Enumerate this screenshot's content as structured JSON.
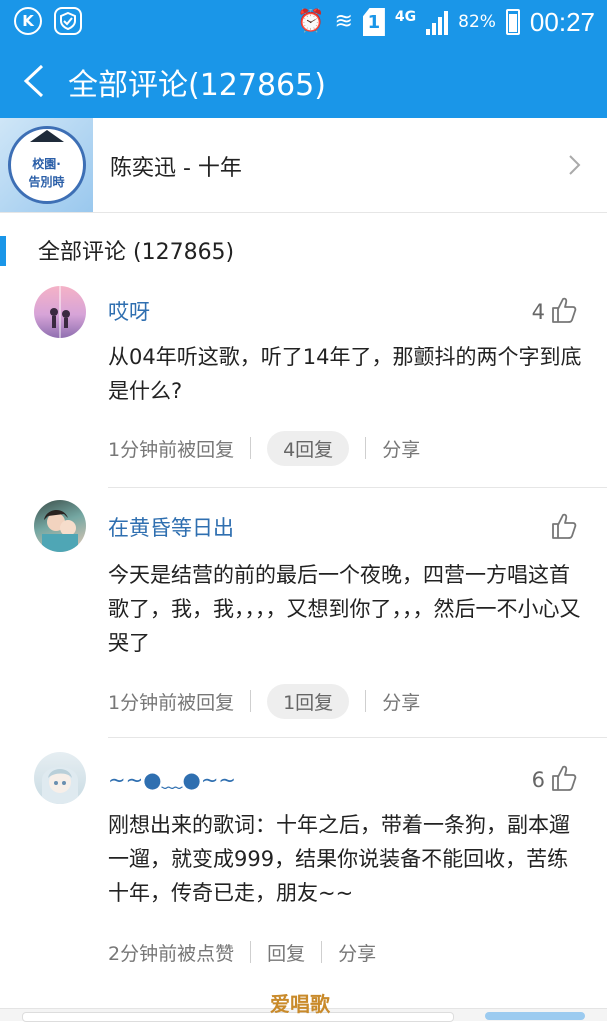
{
  "status_bar": {
    "left_icons": [
      "kugou-app-icon",
      "security-shield-icon"
    ],
    "kugou_glyph": "K",
    "alarm_glyph": "⏰",
    "wifi_glyph": "≋",
    "sim_label": "1",
    "network": "4G",
    "battery": "82%",
    "time": "00:27"
  },
  "header": {
    "title": "全部评论(127865)",
    "back_icon": "back-arrow-icon",
    "background_color": "#1a96e8"
  },
  "song": {
    "cover_line1": "校園·",
    "cover_line2": "告別時",
    "title": "陈奕迅 - 十年"
  },
  "section": {
    "title": "全部评论 (127865)"
  },
  "comments": [
    {
      "username": "哎呀",
      "likes": "4",
      "text": "从04年听这歌，听了14年了，那颤抖的两个字到底是什么?",
      "time": "1分钟前被回复",
      "replies": "4回复",
      "share": "分享"
    },
    {
      "username": "在黄昏等日出",
      "likes": "",
      "text": "今天是结营的前的最后一个夜晚，四营一方唱这首歌了，我，我，，，，又想到你了，，，然后一不小心又哭了",
      "time": "1分钟前被回复",
      "replies": "1回复",
      "share": "分享"
    },
    {
      "username": "~~●﹏●~~",
      "likes": "6",
      "text": "刚想出来的歌词：十年之后，带着一条狗，副本遛一遛，就变成999，结果你说装备不能回收，苦练十年，传奇已走，朋友~~",
      "time": "2分钟前被点赞",
      "replies": "回复",
      "share": "分享"
    }
  ],
  "watermark": "爱唱歌"
}
